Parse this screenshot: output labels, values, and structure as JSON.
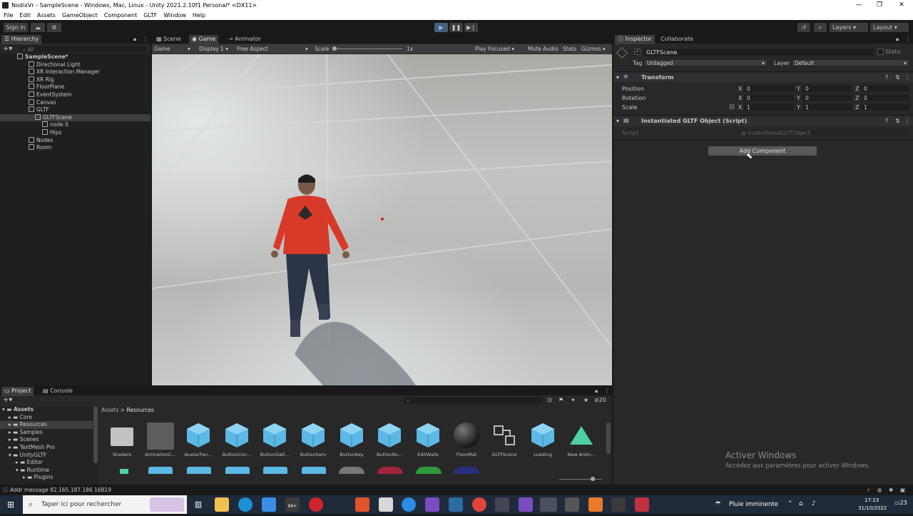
{
  "window": {
    "title": "NodixVr - SampleScene - Windows, Mac, Linux - Unity 2021.2.10f1 Personal* <DX11>"
  },
  "menu": [
    "File",
    "Edit",
    "Assets",
    "GameObject",
    "Component",
    "GLTF",
    "Window",
    "Help"
  ],
  "toolbar": {
    "sign_in": "Sign in",
    "layers": "Layers",
    "layout": "Layout"
  },
  "hierarchy": {
    "tab": "Hierarchy",
    "search_placeholder": "All",
    "items": [
      {
        "label": "SampleScene*",
        "depth": 0,
        "bold": true
      },
      {
        "label": "Directional Light",
        "depth": 1
      },
      {
        "label": "XR Interaction Manager",
        "depth": 1
      },
      {
        "label": "XR Rig",
        "depth": 1
      },
      {
        "label": "FloorPlane",
        "depth": 1
      },
      {
        "label": "EventSystem",
        "depth": 1
      },
      {
        "label": "Canvas",
        "depth": 1
      },
      {
        "label": "GLTF",
        "depth": 1
      },
      {
        "label": "GLTFScene",
        "depth": 2
      },
      {
        "label": "node 0",
        "depth": 3
      },
      {
        "label": "Hips",
        "depth": 3
      },
      {
        "label": "Nodes",
        "depth": 1
      },
      {
        "label": "Room",
        "depth": 1
      }
    ]
  },
  "game": {
    "tabs": [
      "Scene",
      "Game",
      "Animator"
    ],
    "display_mode": "Game",
    "display": "Display 1",
    "aspect": "Free Aspect",
    "scale_label": "Scale",
    "scale_value": "1x",
    "play_focused": "Play Focused",
    "mute_audio": "Mute Audio",
    "stats": "Stats",
    "gizmos": "Gizmos"
  },
  "inspector": {
    "tabs": [
      "Inspector",
      "Collaborate"
    ],
    "object_name": "GLTFScene",
    "static_label": "Static",
    "tag_label": "Tag",
    "tag_value": "Untagged",
    "layer_label": "Layer",
    "layer_value": "Default",
    "transform": {
      "title": "Transform",
      "position_label": "Position",
      "rotation_label": "Rotation",
      "scale_label": "Scale",
      "position": {
        "x": "0",
        "y": "0",
        "z": "0"
      },
      "rotation": {
        "x": "0",
        "y": "0",
        "z": "0"
      },
      "scale": {
        "x": "1",
        "y": "1",
        "z": "1"
      }
    },
    "script_component": {
      "title": "Instantiated GLTF Object (Script)",
      "script_label": "Script",
      "script_value": "InstantiatedGLTFObject"
    },
    "add_component": "Add Component"
  },
  "watermark": {
    "line1": "Activer Windows",
    "line2": "Accédez aux paramètres pour activer Windows."
  },
  "project": {
    "tabs": [
      "Project",
      "Console"
    ],
    "breadcrumb": [
      "Assets",
      "Resources"
    ],
    "badge_count": "20",
    "folders": [
      {
        "label": "Assets",
        "depth": 0
      },
      {
        "label": "Core",
        "depth": 1
      },
      {
        "label": "Resources",
        "depth": 1
      },
      {
        "label": "Samples",
        "depth": 1
      },
      {
        "label": "Scenes",
        "depth": 1
      },
      {
        "label": "TextMesh Pro",
        "depth": 1
      },
      {
        "label": "UnityGLTF",
        "depth": 1
      },
      {
        "label": "Editor",
        "depth": 2
      },
      {
        "label": "Runtime",
        "depth": 2
      },
      {
        "label": "Plugins",
        "depth": 3
      }
    ],
    "assets": [
      "Shaders",
      "AnimationC...",
      "AvatarPan...",
      "ButtonCon...",
      "ButtonGall...",
      "ButtonItem",
      "ButtonKey",
      "ButtonRo...",
      "EditWalls",
      "FloorMat",
      "GLTFScene",
      "Loading",
      "New Anim..."
    ]
  },
  "status": {
    "message": "Addr message 82.165.187.186 16819"
  },
  "taskbar": {
    "search_placeholder": "Taper ici pour rechercher",
    "weather": "Pluie imminente",
    "time": "17:23",
    "date": "31/10/2022",
    "badge": "99+",
    "notif": "23"
  }
}
